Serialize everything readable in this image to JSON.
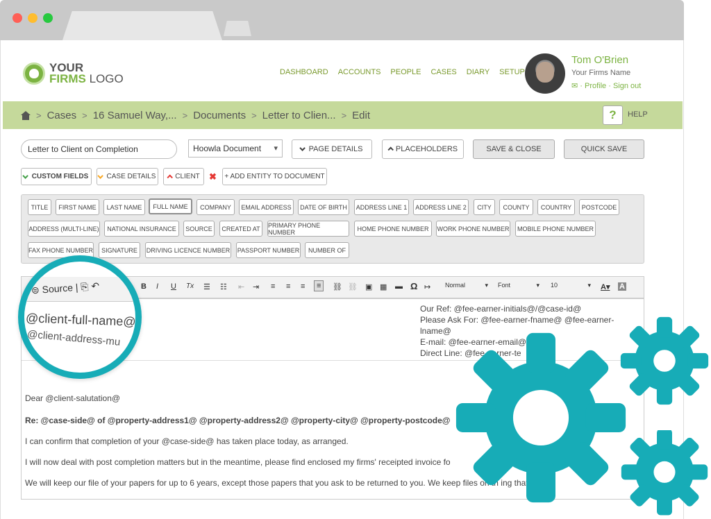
{
  "header": {
    "logo_line1": "YOUR",
    "logo_line2_a": "FIRMS",
    "logo_line2_b": " LOGO",
    "nav": [
      "DASHBOARD",
      "ACCOUNTS",
      "PEOPLE",
      "CASES",
      "DIARY",
      "SETUP"
    ],
    "user_name": "Tom O'Brien",
    "user_firm": "Your Firms Name",
    "user_links": "✉ · Profile · Sign out"
  },
  "breadcrumb": {
    "items": [
      "Cases",
      "16 Samuel Way,...",
      "Documents",
      "Letter to Clien...",
      "Edit"
    ],
    "help_icon": "?",
    "help_label": "HELP"
  },
  "controls": {
    "doc_name": "Letter to Client on Completion",
    "doc_type": "Hoowla Document",
    "page_details": "PAGE DETAILS",
    "placeholders": "PLACEHOLDERS",
    "save_close": "SAVE & CLOSE",
    "quick_save": "QUICK SAVE",
    "custom_fields": "CUSTOM FIELDS",
    "case_details": "CASE DETAILS",
    "client": "CLIENT",
    "remove": "✖",
    "add_entity": "+ ADD ENTITY TO DOCUMENT"
  },
  "placeholder_buttons": [
    "TITLE",
    "FIRST NAME",
    "LAST NAME",
    "FULL NAME",
    "COMPANY",
    "EMAIL ADDRESS",
    "DATE OF BIRTH",
    "ADDRESS LINE 1",
    "ADDRESS LINE 2",
    "CITY",
    "COUNTY",
    "COUNTRY",
    "POSTCODE",
    "ADDRESS (MULTI-LINE)",
    "NATIONAL INSURANCE",
    "SOURCE",
    "CREATED AT",
    "PRIMARY PHONE NUMBER",
    "HOME PHONE NUMBER",
    "WORK PHONE NUMBER",
    "MOBILE PHONE NUMBER",
    "FAX PHONE NUMBER",
    "SIGNATURE",
    "DRIVING LICENCE NUMBER",
    "PASSPORT NUMBER",
    "NUMBER OF"
  ],
  "toolbar": {
    "source": "Source",
    "bold": "B",
    "italic": "I",
    "underline": "U",
    "clear_format": "Tx",
    "style": "Normal",
    "font": "Font",
    "size": "10"
  },
  "editor": {
    "ref_lines": [
      "Our Ref: @fee-earner-initials@/@case-id@",
      "Please Ask For: @fee-earner-fname@ @fee-earner-",
      "lname@",
      "E-mail: @fee-earner-email@",
      "Direct Line: @fee-earner-te"
    ],
    "greeting": "Dear @client-salutation@",
    "subject": "Re: @case-side@ of @property-address1@ @property-address2@ @property-city@ @property-postcode@",
    "para1": "I can confirm that completion of your @case-side@ has taken place today, as arranged.",
    "para2": "I will now deal with post completion matters but in the meantime, please find enclosed my firms' receipted invoice fo",
    "para3": "We will keep our file of your papers for up to 6 years, except those papers that you ask to be returned to you. We keep files on th                ing that we c"
  },
  "magnifier": {
    "source": "Source",
    "line1": "@client-full-name@",
    "line2": "@client-address-mu"
  },
  "colors": {
    "brand_green": "#7cb342",
    "crumb_bar": "#c5d99b",
    "gear_teal": "#17acb7"
  }
}
